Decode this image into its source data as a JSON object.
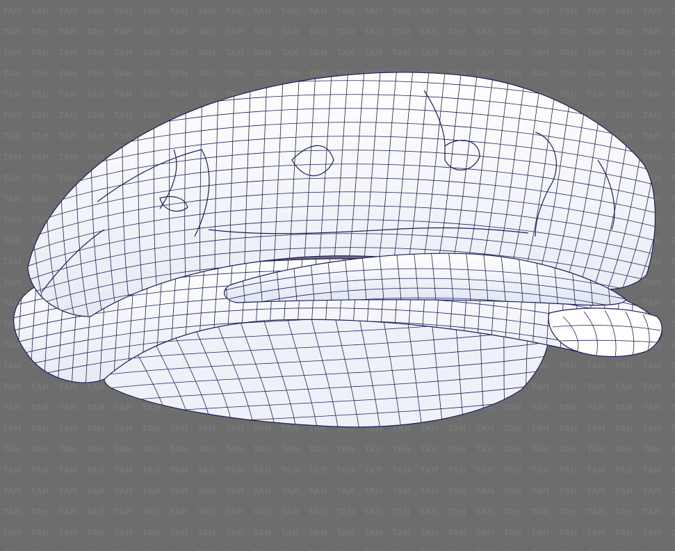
{
  "watermark": {
    "text": "TAH",
    "color": "#7e7e7e"
  },
  "render": {
    "background_color": "#6d6d6d",
    "surface_color": "#ffffff",
    "shade_color": "#dfe6f2",
    "wire_color": "#1c1c5a"
  }
}
